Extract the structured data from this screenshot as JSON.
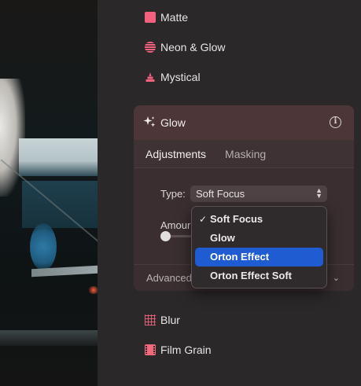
{
  "effects": {
    "matte": {
      "label": "Matte",
      "icon": "matte-icon"
    },
    "neon_glow": {
      "label": "Neon & Glow",
      "icon": "neon-glow-icon"
    },
    "mystical": {
      "label": "Mystical",
      "icon": "mystical-icon"
    },
    "blur": {
      "label": "Blur",
      "icon": "blur-icon"
    },
    "film_grain": {
      "label": "Film Grain",
      "icon": "film-grain-icon"
    }
  },
  "glow_panel": {
    "title": "Glow",
    "title_icon": "sparkle-icon",
    "info_icon": "info-icon",
    "tabs": [
      {
        "label": "Adjustments",
        "active": true
      },
      {
        "label": "Masking",
        "active": false
      }
    ],
    "type_label": "Type:",
    "type_value": "Soft Focus",
    "amount_label": "Amour",
    "amount_value": 0,
    "advanced_label": "Advanced"
  },
  "type_menu": {
    "items": [
      {
        "label": "Soft Focus",
        "checked": true,
        "highlighted": false
      },
      {
        "label": "Glow",
        "checked": false,
        "highlighted": false
      },
      {
        "label": "Orton Effect",
        "checked": false,
        "highlighted": true
      },
      {
        "label": "Orton Effect Soft",
        "checked": false,
        "highlighted": false
      }
    ],
    "check_glyph": "✓"
  },
  "colors": {
    "accent_pink": "#f3617f",
    "menu_highlight": "#1f5bd1",
    "panel_bg": "#2b2829",
    "card_bg": "#3a2e30"
  }
}
